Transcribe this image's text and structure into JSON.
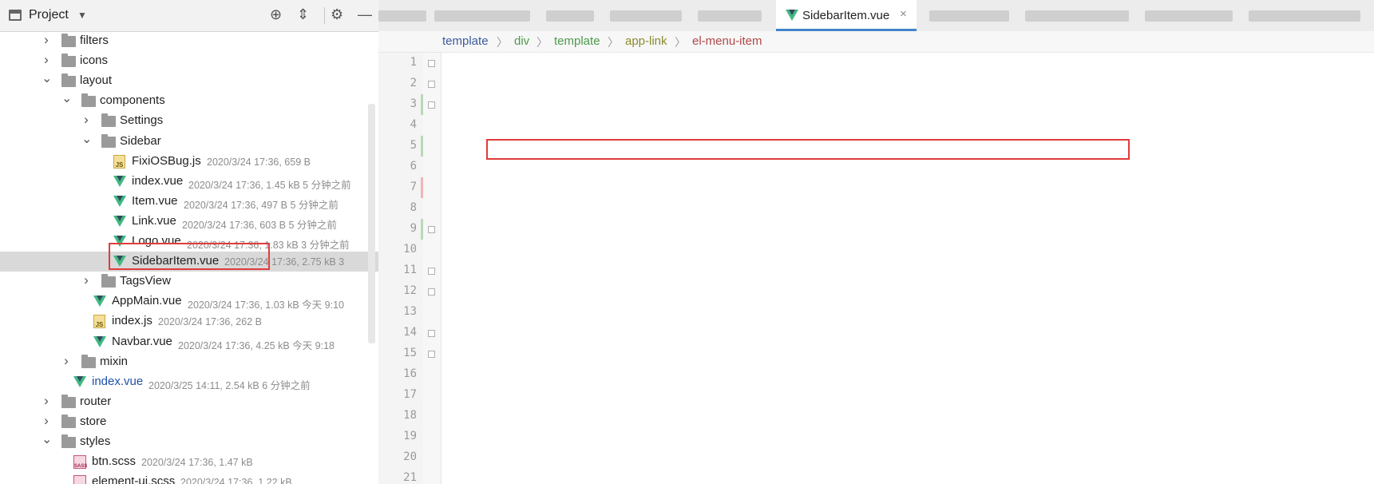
{
  "project_panel": {
    "title": "Project",
    "tree": [
      {
        "name": "filters",
        "type": "folder",
        "depth": 2,
        "expanded": false
      },
      {
        "name": "icons",
        "type": "folder",
        "depth": 2,
        "expanded": false
      },
      {
        "name": "layout",
        "type": "folder",
        "depth": 2,
        "expanded": true
      },
      {
        "name": "components",
        "type": "folder",
        "depth": 3,
        "expanded": true
      },
      {
        "name": "Settings",
        "type": "folder",
        "depth": 4,
        "expanded": false
      },
      {
        "name": "Sidebar",
        "type": "folder",
        "depth": 4,
        "expanded": true
      },
      {
        "name": "FixiOSBug.js",
        "type": "js",
        "depth": 5,
        "meta": "2020/3/24 17:36, 659 B"
      },
      {
        "name": "index.vue",
        "type": "vue",
        "depth": 5,
        "meta": "2020/3/24 17:36, 1.45 kB 5 分钟之前"
      },
      {
        "name": "Item.vue",
        "type": "vue",
        "depth": 5,
        "meta": "2020/3/24 17:36, 497 B 5 分钟之前"
      },
      {
        "name": "Link.vue",
        "type": "vue",
        "depth": 5,
        "meta": "2020/3/24 17:36, 603 B 5 分钟之前"
      },
      {
        "name": "Logo.vue",
        "type": "vue",
        "depth": 5,
        "meta": "2020/3/24 17:36, 1.83 kB 3 分钟之前"
      },
      {
        "name": "SidebarItem.vue",
        "type": "vue",
        "depth": 5,
        "meta": "2020/3/24 17:36, 2.75 kB 3",
        "selected": true
      },
      {
        "name": "TagsView",
        "type": "folder",
        "depth": 4,
        "expanded": false
      },
      {
        "name": "AppMain.vue",
        "type": "vue",
        "depth": 4,
        "meta": "2020/3/24 17:36, 1.03 kB 今天 9:10"
      },
      {
        "name": "index.js",
        "type": "js",
        "depth": 4,
        "meta": "2020/3/24 17:36, 262 B"
      },
      {
        "name": "Navbar.vue",
        "type": "vue",
        "depth": 4,
        "meta": "2020/3/24 17:36, 4.25 kB 今天 9:18"
      },
      {
        "name": "mixin",
        "type": "folder",
        "depth": 3,
        "expanded": false
      },
      {
        "name": "index.vue",
        "type": "vue",
        "depth": 3,
        "meta": "2020/3/25 14:11, 2.54 kB 6 分钟之前",
        "modified": true
      },
      {
        "name": "router",
        "type": "folder",
        "depth": 2,
        "expanded": false
      },
      {
        "name": "store",
        "type": "folder",
        "depth": 2,
        "expanded": false
      },
      {
        "name": "styles",
        "type": "folder",
        "depth": 2,
        "expanded": true
      },
      {
        "name": "btn.scss",
        "type": "sass",
        "depth": 3,
        "meta": "2020/3/24 17:36, 1.47 kB"
      },
      {
        "name": "element-ui.scss",
        "type": "sass",
        "depth": 3,
        "meta": "2020/3/24 17:36, 1.22 kB"
      }
    ]
  },
  "editor": {
    "active_tab": "SidebarItem.vue",
    "breadcrumb": [
      "template",
      "div",
      "template",
      "app-link",
      "el-menu-item"
    ],
    "line_numbers": [
      "1",
      "2",
      "3",
      "4",
      "5",
      "6",
      "7",
      "8",
      "9",
      "10",
      "11",
      "12",
      "13",
      "14",
      "15",
      "16",
      "17",
      "18",
      "19",
      "20",
      "21"
    ]
  },
  "colors": {
    "highlight_box": "#e03c3c",
    "tag": "#000080",
    "string": "#067d17",
    "active_tab_underline": "#4083c9"
  }
}
